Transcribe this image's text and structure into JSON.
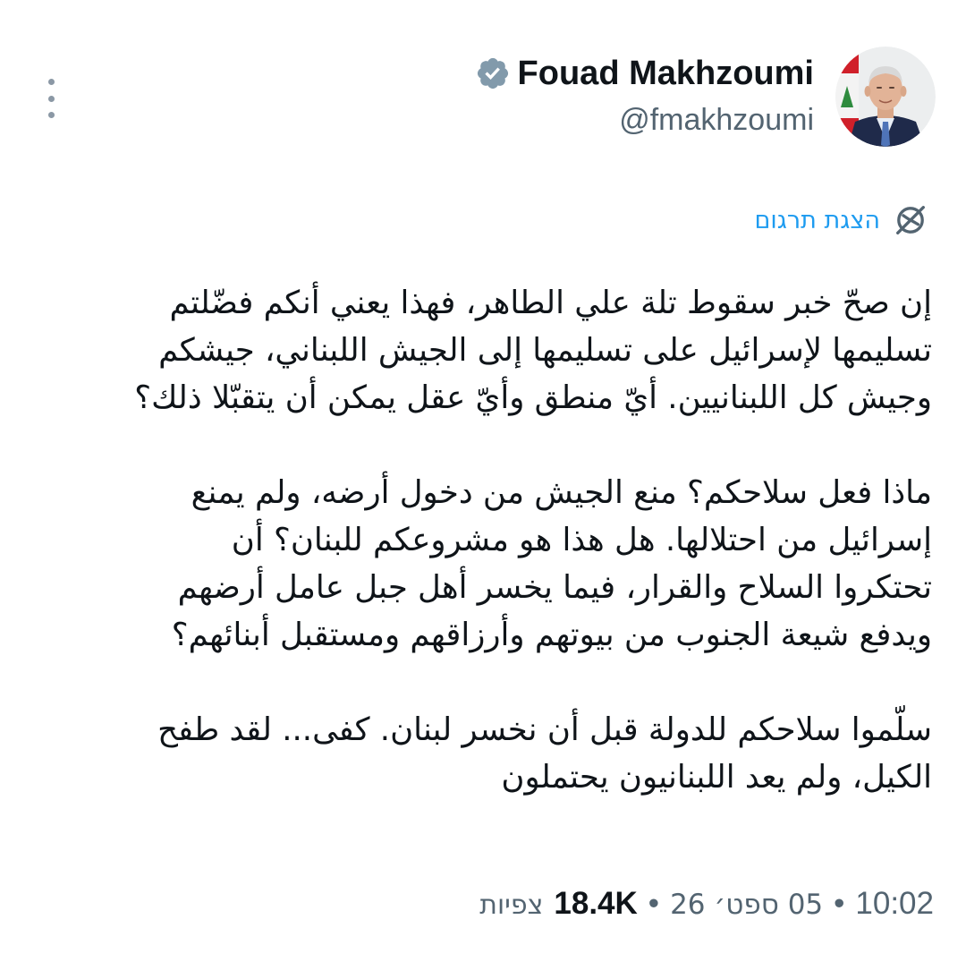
{
  "author": {
    "display_name": "Fouad Makhzoumi",
    "handle": "@fmakhzoumi",
    "verified_icon": "verified-badge-icon",
    "verified_color": "#829aab"
  },
  "menu": {
    "icon": "more-vertical-icon"
  },
  "translation": {
    "label": "הצגת תרגום",
    "icon": "translate-globe-icon",
    "color": "#1d9bf0"
  },
  "tweet": {
    "paragraphs": [
      "إن صحّ خبر سقوط تلة علي الطاهر، فهذا يعني أنكم فضّلتم\nتسليمها لإسرائيل على تسليمها إلى الجيش اللبناني، جيشكم\nوجيش كل اللبنانيين. أيّ منطق وأيّ عقل يمكن أن يتقبّلا ذلك؟",
      "ماذا فعل سلاحكم؟ منع الجيش من دخول أرضه، ولم يمنع\nإسرائيل من احتلالها. هل هذا هو مشروعكم للبنان؟ أن\nتحتكروا السلاح والقرار، فيما يخسر أهل جبل عامل أرضهم\nويدفع شيعة الجنوب من بيوتهم وأرزاقهم ومستقبل أبنائهم؟",
      "سلّموا سلاحكم للدولة قبل أن نخسر لبنان. كفى... لقد طفح\nالكيل، ولم يعد اللبنانيون يحتملون"
    ]
  },
  "meta": {
    "time": "10:02",
    "date": "05 ספט׳ 26",
    "separator": "•",
    "views_count": "18.4K",
    "views_label": "צפיות"
  }
}
